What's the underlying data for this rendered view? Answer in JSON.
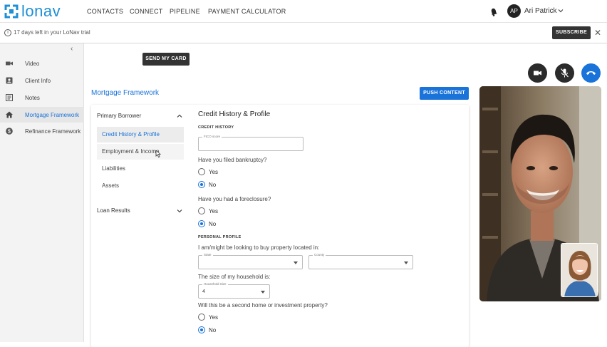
{
  "brand": {
    "name": "lonav",
    "color": "#1d8fd6"
  },
  "nav": {
    "links": [
      "CONTACTS",
      "CONNECT",
      "PIPELINE",
      "PAYMENT CALCULATOR"
    ],
    "user_initials": "AP",
    "user_name": "Ari Patrick"
  },
  "trial": {
    "message": "17 days left in your LoNav trial",
    "subscribe_label": "SUBSCRIBE",
    "close_icon": "close-icon"
  },
  "sidebar": {
    "items": [
      {
        "label": "Video",
        "icon": "video-camera-icon"
      },
      {
        "label": "Client Info",
        "icon": "contact-card-icon"
      },
      {
        "label": "Notes",
        "icon": "notes-icon"
      },
      {
        "label": "Mortgage Framework",
        "icon": "home-icon",
        "active": true
      },
      {
        "label": "Refinance Framework",
        "icon": "dollar-icon"
      }
    ]
  },
  "main": {
    "send_card_label": "SEND MY CARD",
    "section_title": "Mortgage Framework",
    "push_label": "PUSH CONTENT"
  },
  "left_pane": {
    "primary_borrower": "Primary Borrower",
    "items": [
      "Credit History & Profile",
      "Employment & Income",
      "Liabilities",
      "Assets"
    ],
    "loan_results": "Loan Results"
  },
  "form": {
    "title": "Credit History & Profile",
    "credit_history_heading": "CREDIT HISTORY",
    "fico_label": "FICO score",
    "fico_value": "",
    "q_bankruptcy": "Have you filed bankruptcy?",
    "q_foreclosure": "Have you had a foreclosure?",
    "yes": "Yes",
    "no": "No",
    "personal_profile_heading": "PERSONAL PROFILE",
    "q_location": "I am/might be looking to buy property located in:",
    "state_label": "State",
    "state_value": "",
    "county_label": "County",
    "county_value": "",
    "q_household": "The size of my household is:",
    "household_label": "Household Size",
    "household_value": "4",
    "q_second_home": "Will this be a second home or investment property?"
  },
  "call_controls": {
    "camera": {
      "icon": "video-camera-icon",
      "color": "#2b2b2b"
    },
    "mic": {
      "icon": "mic-off-icon",
      "color": "#2b2b2b"
    },
    "hangup": {
      "icon": "phone-hangup-icon",
      "color": "#1a73d9"
    }
  },
  "colors": {
    "accent": "#1a73d9",
    "dark_button": "#333333"
  }
}
